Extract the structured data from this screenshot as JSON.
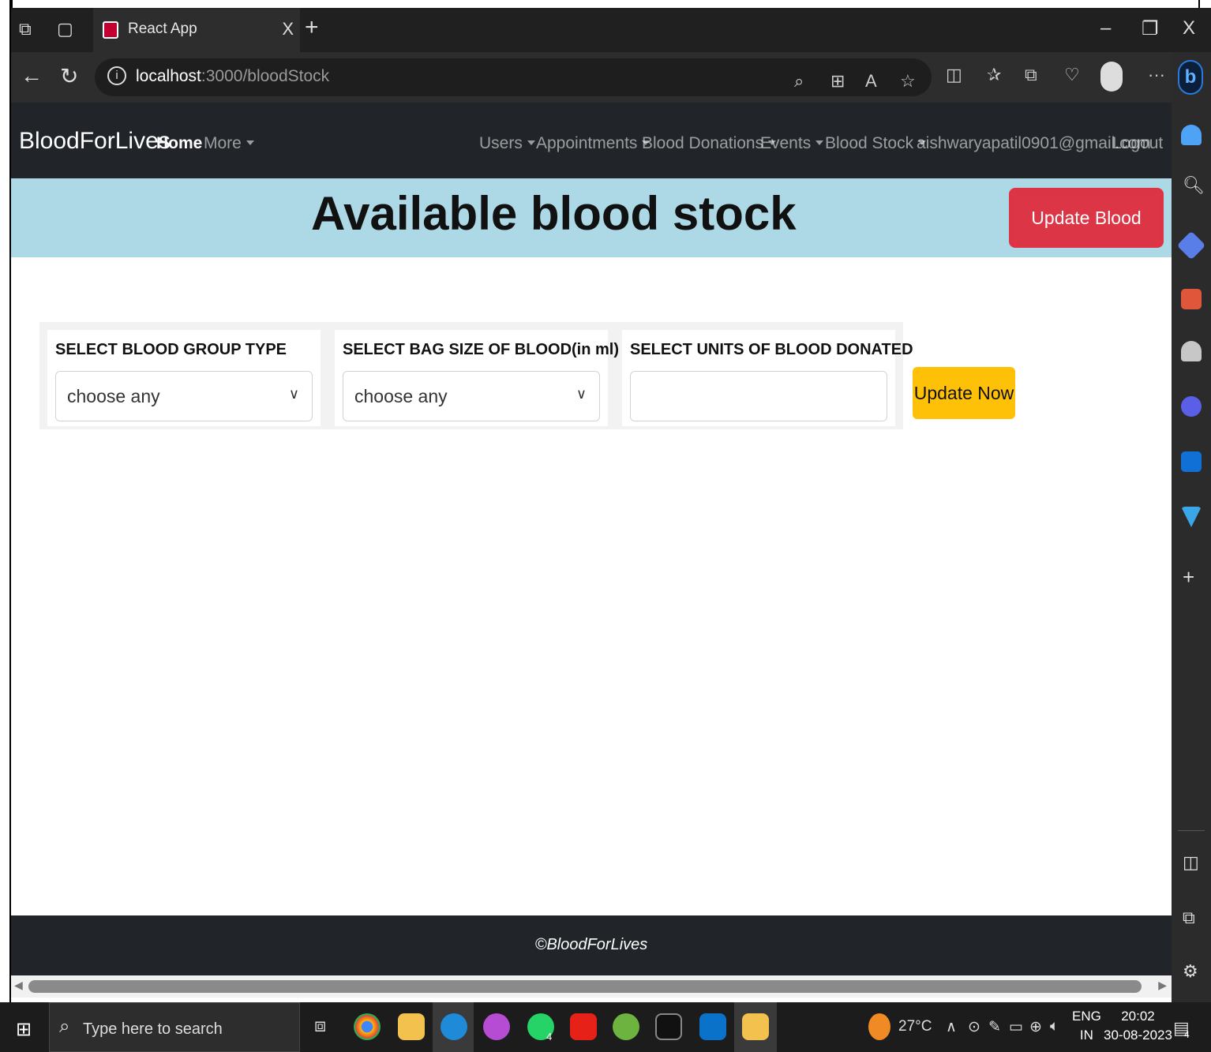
{
  "browser": {
    "tab_title": "React App",
    "tab_close": "X",
    "new_tab": "+",
    "url_host": "localhost",
    "url_path": ":3000/bloodStock",
    "window_min": "–",
    "window_restore": "❐",
    "window_close": "X"
  },
  "navbar": {
    "brand": "BloodForLives",
    "home": "Home",
    "more": "More",
    "users": "Users",
    "appointments": "Appointments",
    "blood_donations": "Blood Donations",
    "events": "Events",
    "blood_stock": "Blood Stock",
    "email": "aishwaryapatil0901@gmail.com",
    "logout": "Logout"
  },
  "hero": {
    "title": "Available blood stock",
    "update_button": "Update Blood Stock"
  },
  "form": {
    "blood_group_label": "SELECT BLOOD GROUP TYPE",
    "blood_group_value": "choose any",
    "bag_size_label": "SELECT BAG SIZE OF BLOOD(in ml)",
    "bag_size_value": "choose any",
    "units_label": "SELECT UNITS OF BLOOD DONATED",
    "units_value": "",
    "submit": "Update Now"
  },
  "footer": {
    "copyright": "©BloodForLives"
  },
  "taskbar": {
    "search_placeholder": "Type here to search",
    "weather": "27°C",
    "lang_line1": "ENG",
    "lang_line2": "IN",
    "time": "20:02",
    "date": "30-08-2023",
    "whatsapp_badge": "4",
    "notifications_badge": "4"
  },
  "colors": {
    "navbar_bg": "#212529",
    "hero_bg": "#add8e6",
    "danger": "#dc3545",
    "warning": "#ffc107"
  }
}
